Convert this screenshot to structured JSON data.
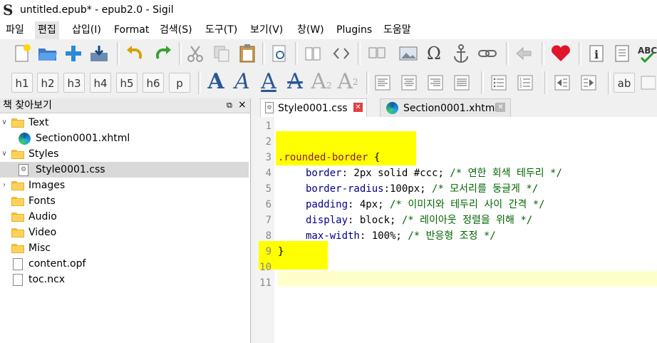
{
  "window": {
    "title": "untitled.epub* - epub2.0 - Sigil"
  },
  "menu": [
    "파일",
    "편집",
    "삽입(I)",
    "Format",
    "검색(S)",
    "도구(T)",
    "보기(V)",
    "창(W)",
    "Plugins",
    "도움말"
  ],
  "heading_buttons": [
    "h1",
    "h2",
    "h3",
    "h4",
    "h5",
    "h6",
    "p"
  ],
  "text_buttons": {
    "ab": "ab"
  },
  "book_browser": {
    "title": "책 찾아보기",
    "items": [
      {
        "label": "Text",
        "type": "folder"
      },
      {
        "label": "Section0001.xhtml",
        "type": "xhtml"
      },
      {
        "label": "Styles",
        "type": "folder"
      },
      {
        "label": "Style0001.css",
        "type": "css"
      },
      {
        "label": "Images",
        "type": "folder"
      },
      {
        "label": "Fonts",
        "type": "folder"
      },
      {
        "label": "Audio",
        "type": "folder"
      },
      {
        "label": "Video",
        "type": "folder"
      },
      {
        "label": "Misc",
        "type": "folder"
      },
      {
        "label": "content.opf",
        "type": "file"
      },
      {
        "label": "toc.ncx",
        "type": "file"
      }
    ]
  },
  "tabs": [
    {
      "label": "Style0001.css",
      "active": true
    },
    {
      "label": "Section0001.xhtml",
      "active": false
    }
  ],
  "editor": {
    "line_numbers": [
      "1",
      "2",
      "3",
      "4",
      "5",
      "6",
      "7",
      "8",
      "9",
      "10",
      "11"
    ],
    "selector": ".rounded-border",
    "open_brace": " {",
    "close_brace": "}",
    "rules": [
      {
        "prop": "border",
        "value": ": 2px solid #ccc; ",
        "comment": "/* 연한 회색 테두리 */"
      },
      {
        "prop": "border-radius",
        "value": ":100px; ",
        "comment": "/* 모서리를 둥글게 */"
      },
      {
        "prop": "padding",
        "value": ": 4px; ",
        "comment": "/* 이미지와 테두리 사이 간격 */"
      },
      {
        "prop": "display",
        "value": ": block; ",
        "comment": "/* 레이아웃 정렬을 위해 */"
      },
      {
        "prop": "max-width",
        "value": ": 100%; ",
        "comment": "/* 반응형 조정 */"
      }
    ]
  },
  "colors": {
    "highlight": "#ffff00",
    "current_line": "#ffffcc",
    "selector": "#8b1a1a",
    "property": "#00008b",
    "comment": "#006400"
  }
}
